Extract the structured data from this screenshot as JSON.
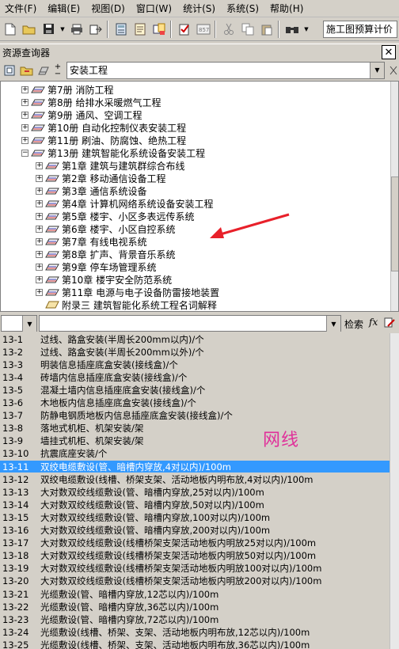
{
  "menu": [
    "文件(F)",
    "编辑(E)",
    "视图(D)",
    "窗口(W)",
    "统计(S)",
    "系统(S)",
    "帮助(H)"
  ],
  "toolbar": {
    "combo_value": "施工图预算计价"
  },
  "panel": {
    "title": "资源查询器",
    "library": "安装工程"
  },
  "tree": [
    {
      "label": "第7册  消防工程"
    },
    {
      "label": "第8册  给排水采暖燃气工程"
    },
    {
      "label": "第9册  通风、空调工程"
    },
    {
      "label": "第10册  自动化控制仪表安装工程"
    },
    {
      "label": "第11册  刷油、防腐蚀、绝热工程"
    },
    {
      "label": "第13册  建筑智能化系统设备安装工程"
    },
    {
      "label": "第1章  建筑与建筑群综合布线"
    },
    {
      "label": "第2章  移动通信设备工程"
    },
    {
      "label": "第3章  通信系统设备"
    },
    {
      "label": "第4章  计算机网络系统设备安装工程"
    },
    {
      "label": "第5章  楼宇、小区多表远传系统"
    },
    {
      "label": "第6章  楼宇、小区自控系统"
    },
    {
      "label": "第7章  有线电视系统"
    },
    {
      "label": "第8章  扩声、背景音乐系统"
    },
    {
      "label": "第9章  停车场管理系统"
    },
    {
      "label": "第10章  楼宇安全防范系统"
    },
    {
      "label": "第11章  电源与电子设备防雷接地装置"
    },
    {
      "label": "附录三  建筑智能化系统工程名词解释"
    }
  ],
  "search": {
    "label": "检索",
    "fx": "fx"
  },
  "items": [
    {
      "code": "13-1",
      "name": "过线、路盒安装(半周长200mm以内)/个"
    },
    {
      "code": "13-2",
      "name": "过线、路盒安装(半周长200mm以外)/个"
    },
    {
      "code": "13-3",
      "name": "明装信息插座底盒安装(接线盒)/个"
    },
    {
      "code": "13-4",
      "name": "砖墙内信息插座底盒安装(接线盒)/个"
    },
    {
      "code": "13-5",
      "name": "混凝土墙内信息插座底盒安装(接线盒)/个"
    },
    {
      "code": "13-6",
      "name": "木地板内信息插座底盒安装(接线盒)/个"
    },
    {
      "code": "13-7",
      "name": "防静电钢质地板内信息插座底盒安装(接线盒)/个"
    },
    {
      "code": "13-8",
      "name": "落地式机柜、机架安装/架"
    },
    {
      "code": "13-9",
      "name": "墙挂式机柜、机架安装/架"
    },
    {
      "code": "13-10",
      "name": "抗震底座安装/个"
    },
    {
      "code": "13-11",
      "name": "双绞电缆敷设(管、暗槽内穿放,4对以内)/100m"
    },
    {
      "code": "13-12",
      "name": "双绞电缆敷设(线槽、桥架支架、活动地板内明布放,4对以内)/100m"
    },
    {
      "code": "13-13",
      "name": "大对数双绞线缆敷设(管、暗槽内穿放,25对以内)/100m"
    },
    {
      "code": "13-14",
      "name": "大对数双绞线缆敷设(管、暗槽内穿放,50对以内)/100m"
    },
    {
      "code": "13-15",
      "name": "大对数双绞线缆敷设(管、暗槽内穿放,100对以内)/100m"
    },
    {
      "code": "13-16",
      "name": "大对数双绞线缆敷设(管、暗槽内穿放,200对以内)/100m"
    },
    {
      "code": "13-17",
      "name": "大对数双绞线缆敷设(线槽桥架支架活动地板内明放25对以内)/100m"
    },
    {
      "code": "13-18",
      "name": "大对数双绞线缆敷设(线槽桥架支架活动地板内明放50对以内)/100m"
    },
    {
      "code": "13-19",
      "name": "大对数双绞线缆敷设(线槽桥架支架活动地板内明放100对以内)/100m"
    },
    {
      "code": "13-20",
      "name": "大对数双绞线缆敷设(线槽桥架支架活动地板内明放200对以内)/100m"
    },
    {
      "code": "13-21",
      "name": "光缆敷设(管、暗槽内穿放,12芯以内)/100m"
    },
    {
      "code": "13-22",
      "name": "光缆敷设(管、暗槽内穿放,36芯以内)/100m"
    },
    {
      "code": "13-23",
      "name": "光缆敷设(管、暗槽内穿放,72芯以内)/100m"
    },
    {
      "code": "13-24",
      "name": "光缆敷设(线槽、桥架、支架、活动地板内明布放,12芯以内)/100m"
    },
    {
      "code": "13-25",
      "name": "光缆敷设(线槽、桥架、支架、活动地板内明布放,36芯以内)/100m"
    }
  ],
  "selected_code": "13-11",
  "annotation": "网线",
  "colors": {
    "selection": "#3399ff",
    "annotation": "#e0309a",
    "arrow": "#e8202a"
  }
}
